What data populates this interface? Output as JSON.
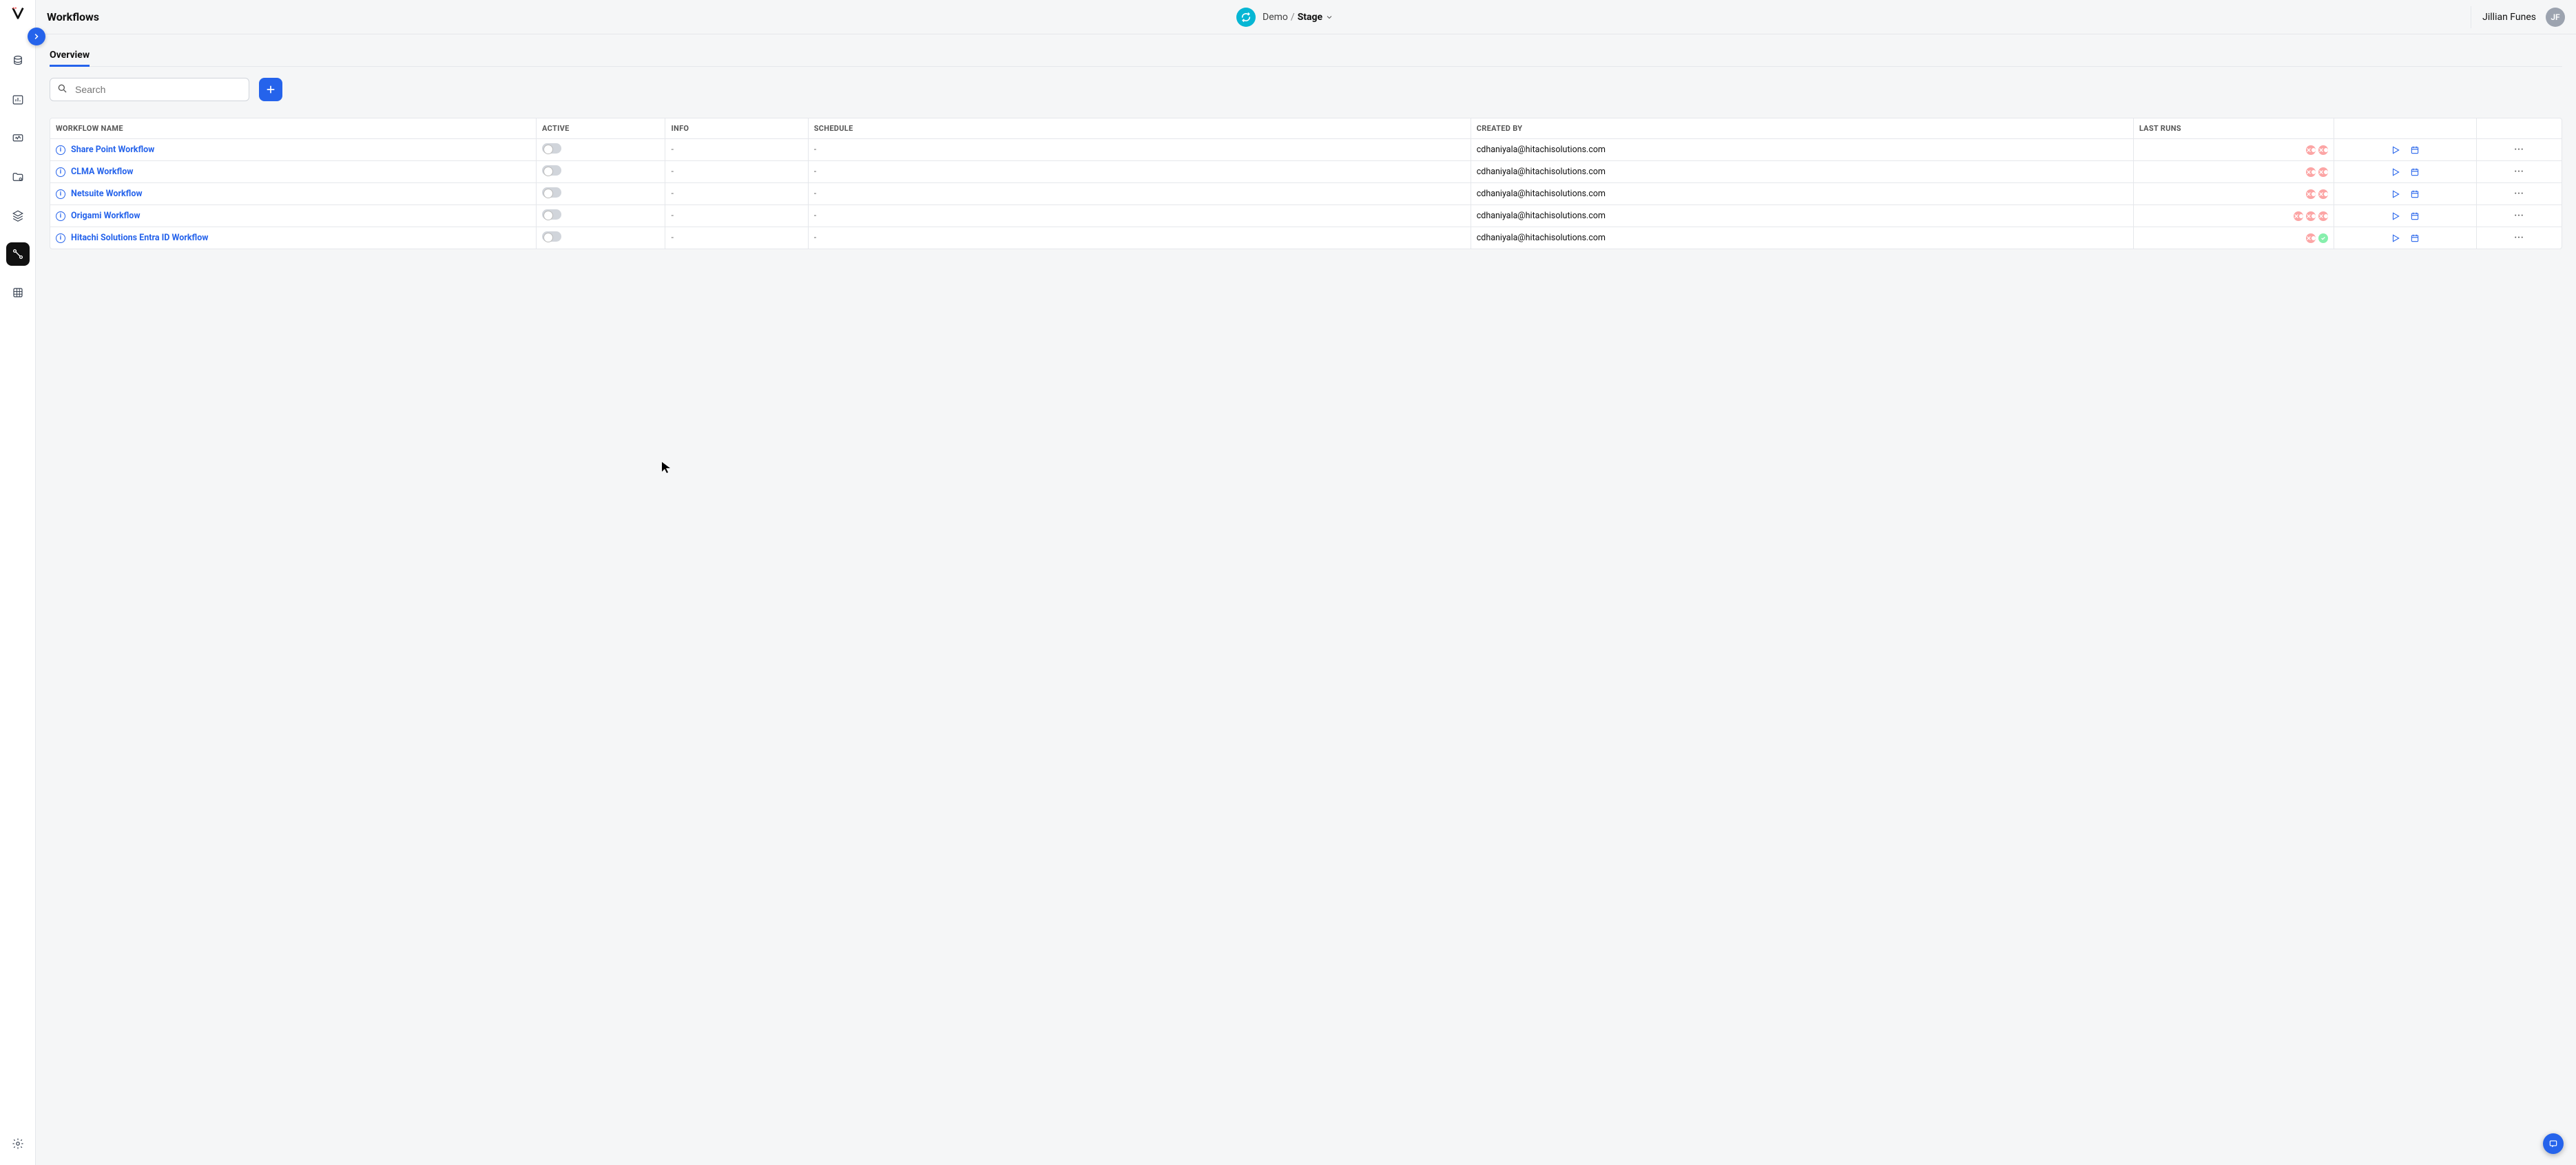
{
  "page_title": "Workflows",
  "env": {
    "org": "Demo",
    "stage": "Stage"
  },
  "user": {
    "name": "Jillian Funes",
    "initials": "JF"
  },
  "tabs": [
    {
      "label": "Overview",
      "active": true
    }
  ],
  "search": {
    "placeholder": "Search",
    "value": ""
  },
  "table": {
    "headers": {
      "name": "Workflow Name",
      "active": "Active",
      "info": "Info",
      "schedule": "Schedule",
      "created_by": "Created By",
      "last_runs": "Last Runs"
    },
    "rows": [
      {
        "name": "Share Point Workflow",
        "active": false,
        "info": "-",
        "schedule": "-",
        "created_by": "cdhaniyala@hitachisolutions.com",
        "runs": [
          "fail",
          "fail"
        ]
      },
      {
        "name": "CLMA Workflow",
        "active": false,
        "info": "-",
        "schedule": "-",
        "created_by": "cdhaniyala@hitachisolutions.com",
        "runs": [
          "fail",
          "fail"
        ]
      },
      {
        "name": "Netsuite Workflow",
        "active": false,
        "info": "-",
        "schedule": "-",
        "created_by": "cdhaniyala@hitachisolutions.com",
        "runs": [
          "fail",
          "fail"
        ]
      },
      {
        "name": "Origami Workflow",
        "active": false,
        "info": "-",
        "schedule": "-",
        "created_by": "cdhaniyala@hitachisolutions.com",
        "runs": [
          "fail",
          "fail",
          "fail"
        ]
      },
      {
        "name": "Hitachi Solutions Entra ID Workflow",
        "active": false,
        "info": "-",
        "schedule": "-",
        "created_by": "cdhaniyala@hitachisolutions.com",
        "runs": [
          "fail",
          "ok"
        ]
      }
    ]
  },
  "sidebar": {
    "items": [
      {
        "id": "database",
        "active": false
      },
      {
        "id": "dashboard",
        "active": false
      },
      {
        "id": "monitor",
        "active": false
      },
      {
        "id": "quality",
        "active": false
      },
      {
        "id": "layers",
        "active": false
      },
      {
        "id": "workflows",
        "active": true
      },
      {
        "id": "tables",
        "active": false
      }
    ],
    "settings": {
      "id": "settings"
    }
  }
}
